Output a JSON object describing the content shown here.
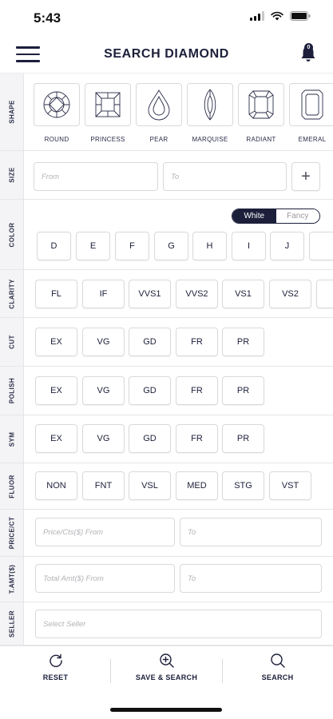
{
  "status_bar": {
    "time": "5:43"
  },
  "header": {
    "title": "SEARCH DIAMOND",
    "notification_count": "0"
  },
  "rows": {
    "shape": {
      "label": "SHAPE",
      "items": [
        "ROUND",
        "PRINCESS",
        "PEAR",
        "MARQUISE",
        "RADIANT",
        "EMERAL"
      ]
    },
    "size": {
      "label": "SIZE",
      "from_placeholder": "From",
      "to_placeholder": "To",
      "add": "+"
    },
    "color": {
      "label": "COLOR",
      "toggle": [
        "White",
        "Fancy"
      ],
      "items": [
        "D",
        "E",
        "F",
        "G",
        "H",
        "I",
        "J",
        ""
      ]
    },
    "clarity": {
      "label": "CLARITY",
      "items": [
        "FL",
        "IF",
        "VVS1",
        "VVS2",
        "VS1",
        "VS2",
        ""
      ]
    },
    "cut": {
      "label": "CUT",
      "items": [
        "EX",
        "VG",
        "GD",
        "FR",
        "PR"
      ]
    },
    "polish": {
      "label": "POLISH",
      "items": [
        "EX",
        "VG",
        "GD",
        "FR",
        "PR"
      ]
    },
    "sym": {
      "label": "SYM",
      "items": [
        "EX",
        "VG",
        "GD",
        "FR",
        "PR"
      ]
    },
    "fluor": {
      "label": "FLUOR",
      "items": [
        "NON",
        "FNT",
        "VSL",
        "MED",
        "STG",
        "VST"
      ]
    },
    "price": {
      "label": "PRICE/CT",
      "from_placeholder": "Price/Cts($) From",
      "to_placeholder": "To"
    },
    "tamt": {
      "label": "T.AMT($)",
      "from_placeholder": "Total Amt($) From",
      "to_placeholder": "To"
    },
    "seller": {
      "label": "SELLER",
      "placeholder": "Select Seller"
    }
  },
  "bottom_bar": {
    "reset": "RESET",
    "save_search": "SAVE & SEARCH",
    "search": "SEARCH"
  },
  "colors": {
    "primary": "#1c1f3a",
    "border": "#d9d9dc",
    "label_bg": "#f4f4f6"
  }
}
